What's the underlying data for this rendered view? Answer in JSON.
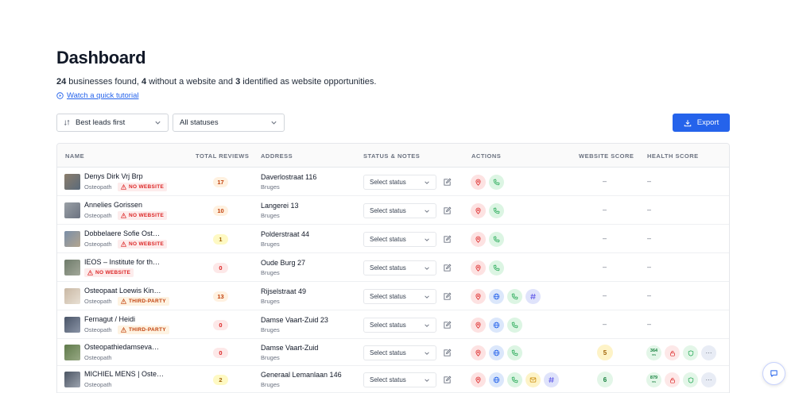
{
  "header": {
    "title": "Dashboard",
    "summary": {
      "count_total": "24",
      "text1": " businesses found, ",
      "count_no_website": "4",
      "text2": " without a website and ",
      "count_opportunities": "3",
      "text3": " identified as website opportunities."
    },
    "tutorial_link": "Watch a quick tutorial"
  },
  "filters": {
    "sort_value": "Best leads first",
    "status_value": "All statuses"
  },
  "export_label": "Export",
  "table": {
    "columns": [
      "NAME",
      "TOTAL REVIEWS",
      "ADDRESS",
      "STATUS & NOTES",
      "ACTIONS",
      "WEBSITE SCORE",
      "HEALTH SCORE"
    ],
    "status_placeholder": "Select status",
    "dash": "–",
    "rows": [
      {
        "name": "Denys Dirk Vrj Brp",
        "category": "Osteopath",
        "badge": "NO WEBSITE",
        "badge_type": "no-web",
        "reviews": "17",
        "review_color": "orange",
        "street": "Daverlostraat 116",
        "city": "Bruges",
        "actions": [
          "map-pin",
          "phone"
        ],
        "website_score": "",
        "health": ""
      },
      {
        "name": "Annelies Gorissen",
        "category": "Osteopath",
        "badge": "NO WEBSITE",
        "badge_type": "no-web",
        "reviews": "10",
        "review_color": "orange",
        "street": "Langerei 13",
        "city": "Bruges",
        "actions": [
          "map-pin",
          "phone"
        ],
        "website_score": "",
        "health": ""
      },
      {
        "name": "Dobbelaere Sofie Ost…",
        "category": "Osteopath",
        "badge": "NO WEBSITE",
        "badge_type": "no-web",
        "reviews": "1",
        "review_color": "yellow",
        "street": "Polderstraat 44",
        "city": "Bruges",
        "actions": [
          "map-pin",
          "phone"
        ],
        "website_score": "",
        "health": ""
      },
      {
        "name": "IEOS – Institute for th…",
        "category": "",
        "badge": "NO WEBSITE",
        "badge_type": "no-web",
        "reviews": "0",
        "review_color": "red",
        "street": "Oude Burg 27",
        "city": "Bruges",
        "actions": [
          "map-pin",
          "phone"
        ],
        "website_score": "",
        "health": ""
      },
      {
        "name": "Osteopaat Loewis Kin…",
        "category": "Osteopath",
        "badge": "THIRD-PARTY",
        "badge_type": "third",
        "reviews": "13",
        "review_color": "orange",
        "street": "Rijselstraat 49",
        "city": "Bruges",
        "actions": [
          "map-pin",
          "globe",
          "phone",
          "hash"
        ],
        "website_score": "",
        "health": ""
      },
      {
        "name": "Fernagut / Heidi",
        "category": "Osteopath",
        "badge": "THIRD-PARTY",
        "badge_type": "third",
        "reviews": "0",
        "review_color": "red",
        "street": "Damse Vaart-Zuid 23",
        "city": "Bruges",
        "actions": [
          "map-pin",
          "globe",
          "phone"
        ],
        "website_score": "",
        "health": ""
      },
      {
        "name": "Osteopathiedamseva…",
        "category": "Osteopath",
        "badge": "",
        "badge_type": "",
        "reviews": "0",
        "review_color": "red",
        "street": "Damse Vaart-Zuid",
        "city": "Bruges",
        "actions": [
          "map-pin",
          "globe",
          "phone"
        ],
        "website_score": "5",
        "score_color": "yellow",
        "health": "364",
        "health_unit": "ms"
      },
      {
        "name": "MICHIEL MENS | Oste…",
        "category": "Osteopath",
        "badge": "",
        "badge_type": "",
        "reviews": "2",
        "review_color": "yellow",
        "street": "Generaal Lemanlaan 146",
        "city": "Bruges",
        "actions": [
          "map-pin",
          "globe",
          "phone",
          "mail",
          "hash"
        ],
        "website_score": "6",
        "score_color": "green",
        "health": "879",
        "health_unit": "ms"
      }
    ]
  },
  "colors": {
    "accent": "#2563eb",
    "no_website_badge": "#dc2626",
    "third_party_badge": "#c2410c"
  }
}
